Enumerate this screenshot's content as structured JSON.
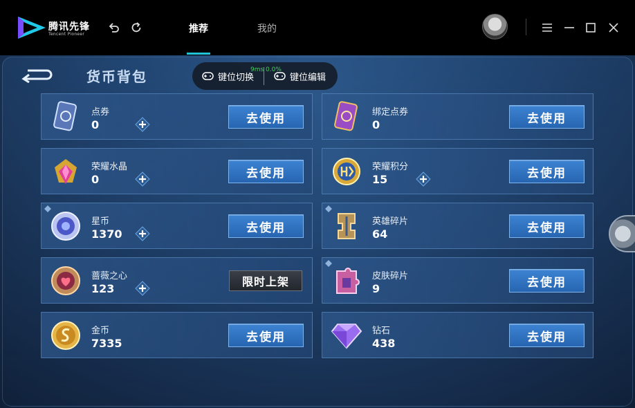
{
  "app": {
    "name": "腾讯先锋",
    "subtitle": "Tencent Pioneer"
  },
  "tabs": [
    {
      "label": "推荐",
      "active": true
    },
    {
      "label": "我的",
      "active": false
    }
  ],
  "window_controls": [
    "menu-icon",
    "minimize-icon",
    "maximize-icon",
    "close-icon"
  ],
  "game": {
    "title": "货币背包",
    "overlay": {
      "ping": "9ms 0.0%",
      "switch_label": "键位切换",
      "edit_label": "键位编辑"
    },
    "use_label": "去使用",
    "limited_label": "限时上架",
    "items": [
      {
        "name": "点券",
        "value": "0",
        "icon": "coupon-card-icon",
        "plus": true,
        "action": "use"
      },
      {
        "name": "绑定点券",
        "value": "0",
        "icon": "bound-coupon-card-icon",
        "plus": false,
        "action": "use"
      },
      {
        "name": "荣耀水晶",
        "value": "0",
        "icon": "glory-crystal-icon",
        "plus": true,
        "action": "use"
      },
      {
        "name": "荣耀积分",
        "value": "15",
        "icon": "glory-points-icon",
        "plus": true,
        "action": "use"
      },
      {
        "name": "星币",
        "value": "1370",
        "icon": "star-coin-icon",
        "plus": true,
        "action": "use"
      },
      {
        "name": "英雄碎片",
        "value": "64",
        "icon": "hero-fragment-icon",
        "plus": false,
        "action": "use"
      },
      {
        "name": "蔷薇之心",
        "value": "123",
        "icon": "rose-heart-icon",
        "plus": true,
        "action": "limited"
      },
      {
        "name": "皮肤碎片",
        "value": "9",
        "icon": "skin-fragment-icon",
        "plus": false,
        "action": "use"
      },
      {
        "name": "金币",
        "value": "7335",
        "icon": "gold-coin-icon",
        "plus": false,
        "action": "use"
      },
      {
        "name": "钻石",
        "value": "438",
        "icon": "diamond-icon",
        "plus": false,
        "action": "use"
      }
    ]
  },
  "colors": {
    "accent": "#1fc4d6",
    "use_button": "#2f74c4",
    "ping": "#3fd35a"
  }
}
